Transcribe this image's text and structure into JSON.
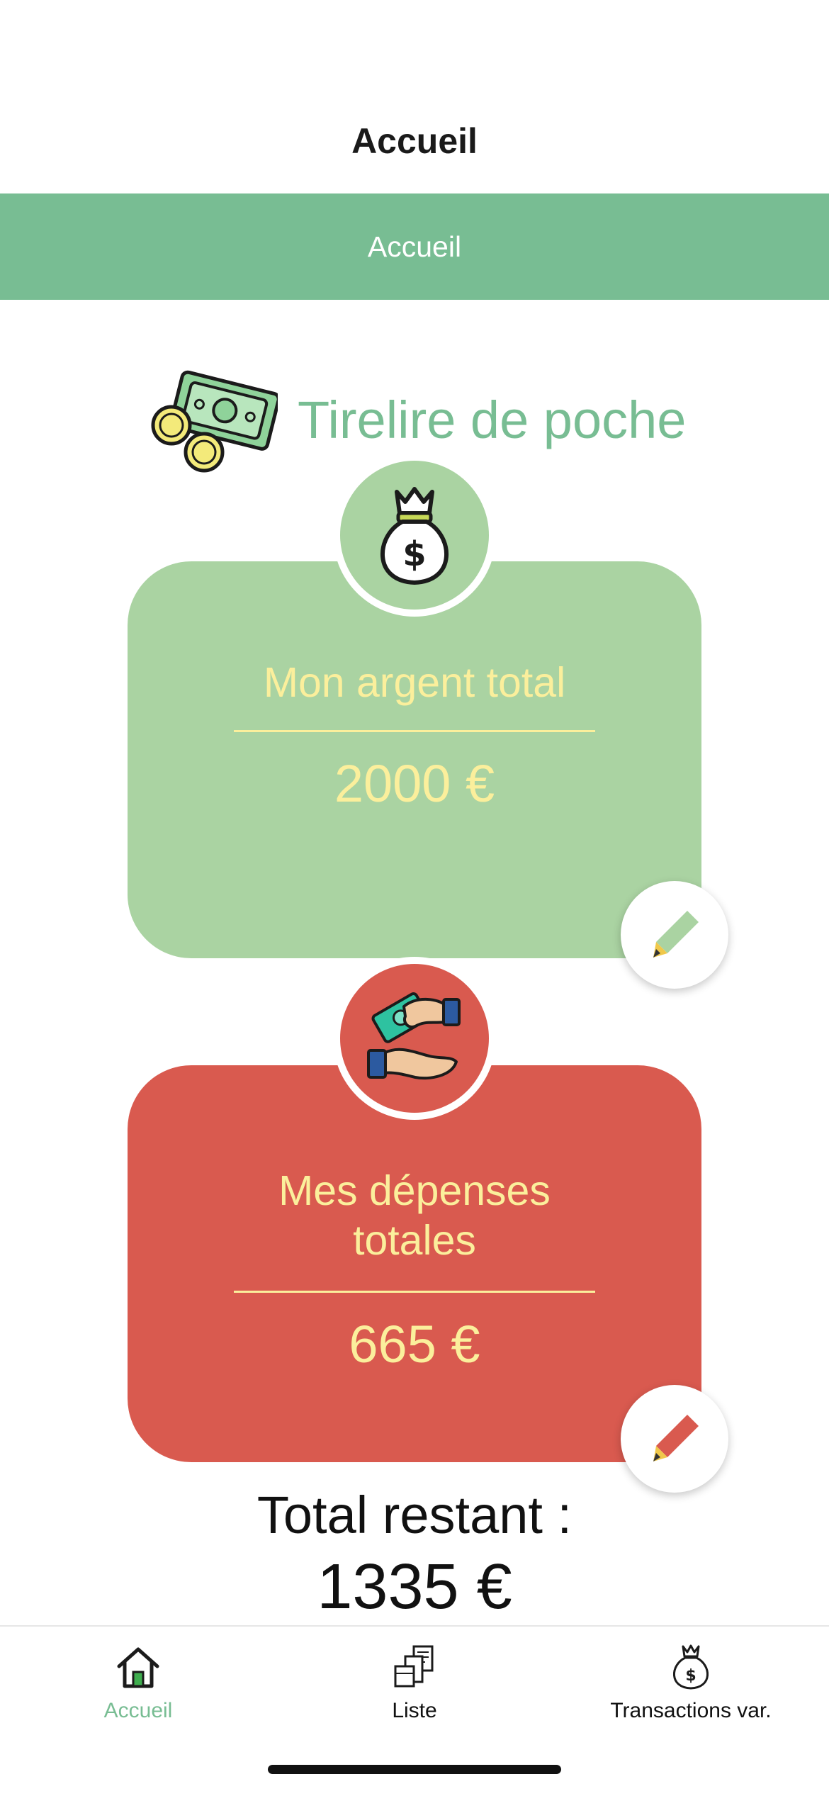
{
  "nav": {
    "title": "Accueil"
  },
  "banner": {
    "label": "Accueil"
  },
  "brand": {
    "title": "Tirelire de poche",
    "icon": "money-bills-coins-icon"
  },
  "cards": {
    "total": {
      "label": "Mon argent total",
      "value": "2000 €",
      "icon": "money-bag-icon",
      "color": "#aad3a2"
    },
    "expenses": {
      "label_line1": "Mes dépenses",
      "label_line2": "totales",
      "value": "665 €",
      "icon": "hands-money-icon",
      "color": "#d95a4f"
    }
  },
  "remaining": {
    "label": "Total restant :",
    "value": "1335 €"
  },
  "tabs": [
    {
      "label": "Accueil",
      "icon": "home-icon",
      "active": true
    },
    {
      "label": "Liste",
      "icon": "receipts-icon",
      "active": false
    },
    {
      "label": "Transactions var.",
      "icon": "money-bag-icon",
      "active": false
    }
  ],
  "colors": {
    "accent": "#78bd93",
    "text_highlight": "#fbef9c"
  }
}
